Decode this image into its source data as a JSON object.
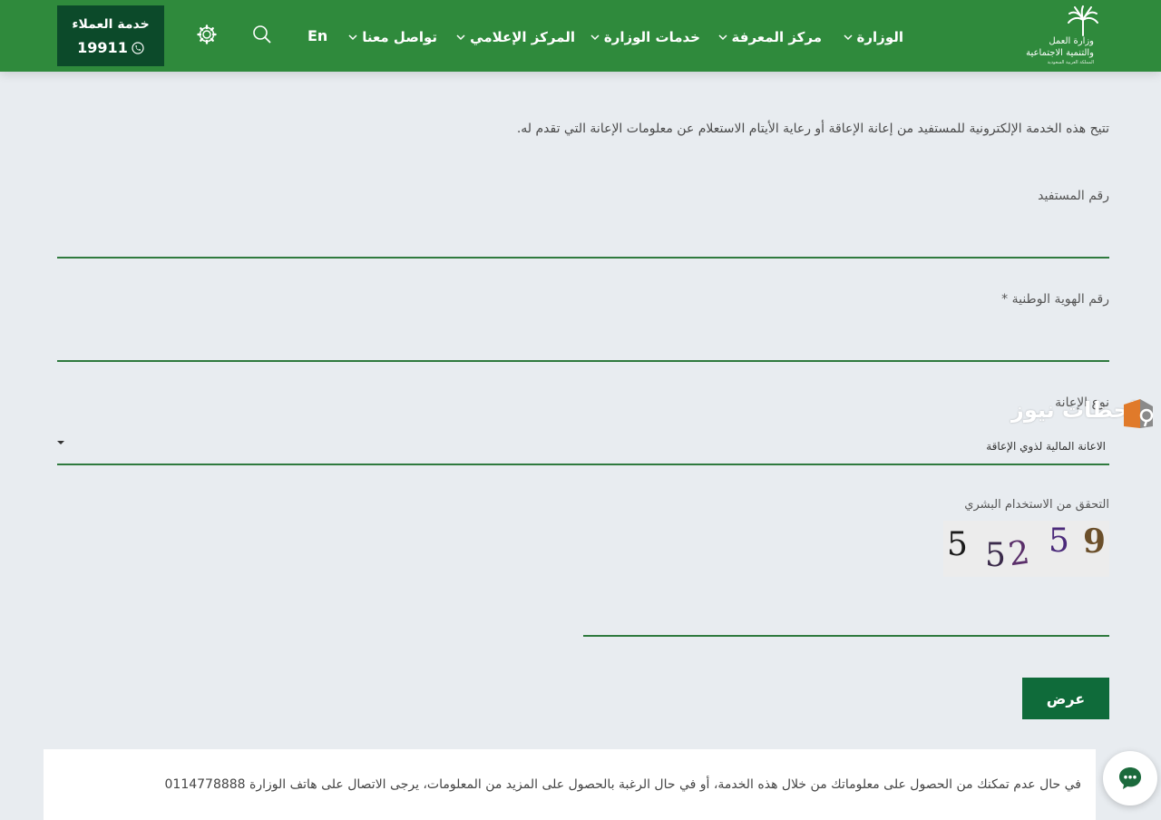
{
  "header": {
    "logo": {
      "line1": "وزارة العمل",
      "line2": "والتنمية الاجتماعية",
      "line3": "المملكة العربية السعودية",
      "icon": "palm-tree-icon"
    },
    "nav": [
      {
        "label": "الوزارة"
      },
      {
        "label": "مركز المعرفة"
      },
      {
        "label": "خدمات الوزارة"
      },
      {
        "label": "المركز الإعلامي"
      },
      {
        "label": "تواصل معنا"
      }
    ],
    "lang_label": "En",
    "search_icon": "search-icon",
    "settings_icon": "gear-icon",
    "support": {
      "label": "خدمة العملاء",
      "number": "19911",
      "icon": "phone-icon"
    }
  },
  "form": {
    "intro": "تتيح هذه الخدمة الإلكترونية للمستفيد من إعانة الإعاقة أو رعاية الأيتام الاستعلام عن معلومات الإعانة التي تقدم له.",
    "beneficiary_label": "رقم المستفيد",
    "national_id_label": "رقم الهوية الوطنية *",
    "aid_type_label": "نوع الإعانة",
    "aid_type_value": "الاعانة المالية لذوي الإعاقة",
    "captcha_label": "التحقق من الاستخدام البشري",
    "captcha_chars": [
      "5",
      "5",
      "2",
      "5",
      "9"
    ],
    "submit_label": "عرض"
  },
  "watermark": {
    "text": "لحظات نيوز"
  },
  "notice": {
    "text": "في حال عدم تمكنك من الحصول على معلوماتك من خلال هذه الخدمة، أو في حال الرغبة بالحصول على المزيد من المعلومات، يرجى الاتصال على هاتف الوزارة 0114778888"
  },
  "chat_icon": "chat-icon",
  "colors": {
    "header": "#2f8a3c",
    "support_bg": "#0c4a2a",
    "button": "#0f6b3a",
    "underline": "#2f7a3e",
    "background": "#e8ecf0"
  }
}
